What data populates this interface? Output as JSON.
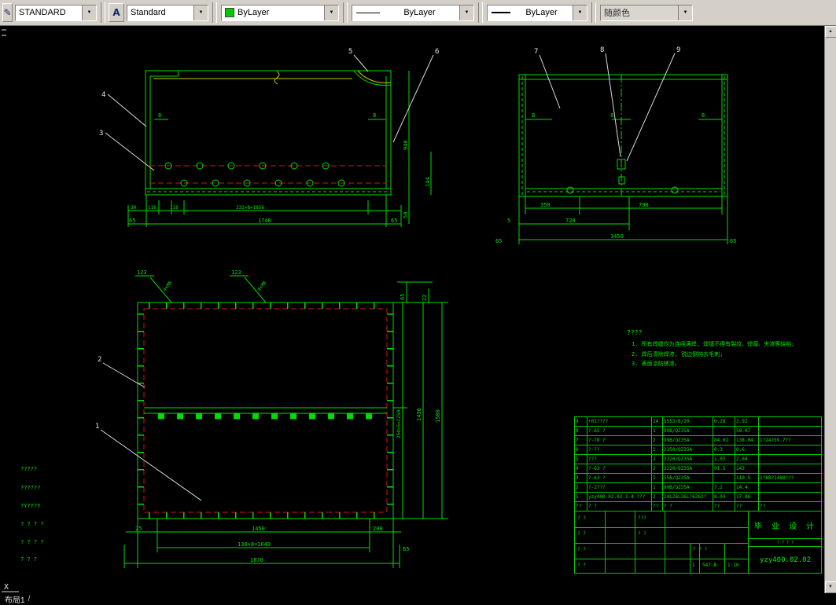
{
  "toolbar": {
    "dim_style_value": "STANDARD",
    "text_style_value": "Standard",
    "color_value": "ByLayer",
    "linetype_value": "ByLayer",
    "lineweight_value": "ByLayer",
    "plot_style_value": "随颜色",
    "dropdown_arrow": "▼",
    "dim_style_icon_glyph": "✎",
    "text_style_icon_glyph": "A"
  },
  "status": {
    "layout_tab": "布局1",
    "separator": "/",
    "ucs_label": "X"
  },
  "colors": {
    "line_green": "#00dc00",
    "text_green": "#00e600",
    "hole_red": "#dd1111",
    "break_yellow": "#cccc00",
    "leader_white": "#d9d9d9",
    "canvas_bg": "#000000",
    "toolbar_bg": "#d4d0c8"
  },
  "balloons": {
    "b1": "1",
    "b2": "2",
    "b3": "3",
    "b4": "4",
    "b5": "5",
    "b6": "6",
    "b7": "7",
    "b8": "8",
    "b9": "9"
  },
  "front_view": {
    "dim_30": "30",
    "dim_116a": "116",
    "dim_116b": "116",
    "dim_pitch": "232×8=1856",
    "dim_1740": "1740",
    "dim_65_left": "65",
    "dim_65_right": "65",
    "dim_8_left": "8",
    "dim_8_right": "8",
    "dim_940": "940",
    "dim_144": "144",
    "dim_50": "50"
  },
  "side_view": {
    "dim_8a": "8",
    "dim_8b": "8",
    "dim_8c": "8",
    "dim_350": "350",
    "dim_790": "790",
    "dim_720": "720",
    "dim_1450": "1450",
    "dim_65_left": "65",
    "dim_65_right": "65",
    "dim_5": "5"
  },
  "plan_view": {
    "dim_123a": "123",
    "dim_123b": "123",
    "thread_a": "4×M8",
    "thread_b": "4×M8",
    "dim_65_top": "65",
    "dim_22": "22",
    "dim_pitch_v": "250×5=1250",
    "dim_1436": "1436",
    "dim_1580": "1580",
    "dim_25": "25",
    "dim_1450": "1450",
    "dim_200": "200",
    "dim_pitch_h": "130×8=1040",
    "dim_1870": "1870",
    "dim_65_bottom": "65"
  },
  "notes": {
    "title": "????",
    "line1": "1. 所有焊缝均为连续满焊, 焊缝不得有裂纹、焊瘤、夹渣等缺陷;",
    "line2": "2. 焊后清除焊渣, 锐边倒钝去毛刺;",
    "line3": "3. 表面涂防锈漆。"
  },
  "stamps": [
    "?????",
    "??????",
    "?Y?Y?Y",
    "? ? ? ?",
    "? ? ? ?",
    "? ? ?"
  ],
  "parts_table": {
    "rows": [
      {
        "seq": "9",
        "code": "+01????",
        "qty": "14",
        "mat": "5553/8/20",
        "unit": "0.28",
        "total": "3.92",
        "note": ""
      },
      {
        "seq": "8",
        "code": "?-65 ?",
        "qty": "1",
        "mat": "99B/QZ35A",
        "unit": "",
        "total": "58.07",
        "note": ""
      },
      {
        "seq": "7",
        "code": "?-78 ?",
        "qty": "2",
        "mat": "99B/QZ35A",
        "unit": "84.02",
        "total": "138.04",
        "note": "1?24?59.7??"
      },
      {
        "seq": "6",
        "code": "?-??",
        "qty": "1",
        "mat": "2350/QZ35A",
        "unit": "0.3",
        "total": "0.6",
        "note": ""
      },
      {
        "seq": "5",
        "code": "???",
        "qty": "2",
        "mat": "3320/QZ35A",
        "unit": "1.02",
        "total": "2.04",
        "note": ""
      },
      {
        "seq": "4",
        "code": "?-63 ?",
        "qty": "2",
        "mat": "3220/QZ35A",
        "unit": "91.5",
        "total": "143",
        "note": ""
      },
      {
        "seq": "3",
        "code": "?-63 ?",
        "qty": "1",
        "mat": "55B/QZ35A",
        "unit": "",
        "total": "119.5",
        "note": "1?80?1480???"
      },
      {
        "seq": "2",
        "code": "?-2???",
        "qty": "1",
        "mat": "99B/QZ35A",
        "unit": "7.2",
        "total": "14.4",
        "note": ""
      },
      {
        "seq": "1",
        "code": "yzy400.02.02.1-4 ???",
        "qty": "2",
        "mat": "24L26L26L?6262?",
        "unit": "8.03",
        "total": "17.86",
        "note": ""
      }
    ],
    "header": [
      "??",
      "? ?",
      "??",
      "? ?",
      "??",
      "??",
      "??"
    ]
  },
  "title_block": {
    "project": "毕 业 设 计",
    "drawing_no": "yzy400.02.02",
    "sheet_row": "? ? ? ?",
    "sig_row1": "? ?",
    "sig_row2": "? ?",
    "sig_row3": "? ?",
    "sig_row4": "? ?",
    "mid1": "???",
    "mid2": "? ?",
    "mid3": "? ? ?",
    "sheet_no": "1",
    "weight": "547.8",
    "scale": "1:10"
  }
}
